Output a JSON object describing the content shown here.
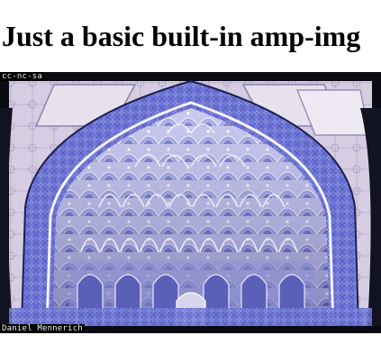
{
  "page": {
    "title": "Just a basic built-in amp-img"
  },
  "image": {
    "license_label": "cc-nc-sa",
    "author_label": "Daniel Mennerich",
    "subject_icon": "mosque-iwan-muqarnas-photo",
    "colors": {
      "frame": "#0a0a12",
      "tile_blue": "#6f78d8",
      "tile_light": "#c9c6f0",
      "stone": "#d8cfe6",
      "shadow": "#3c3f86"
    }
  }
}
